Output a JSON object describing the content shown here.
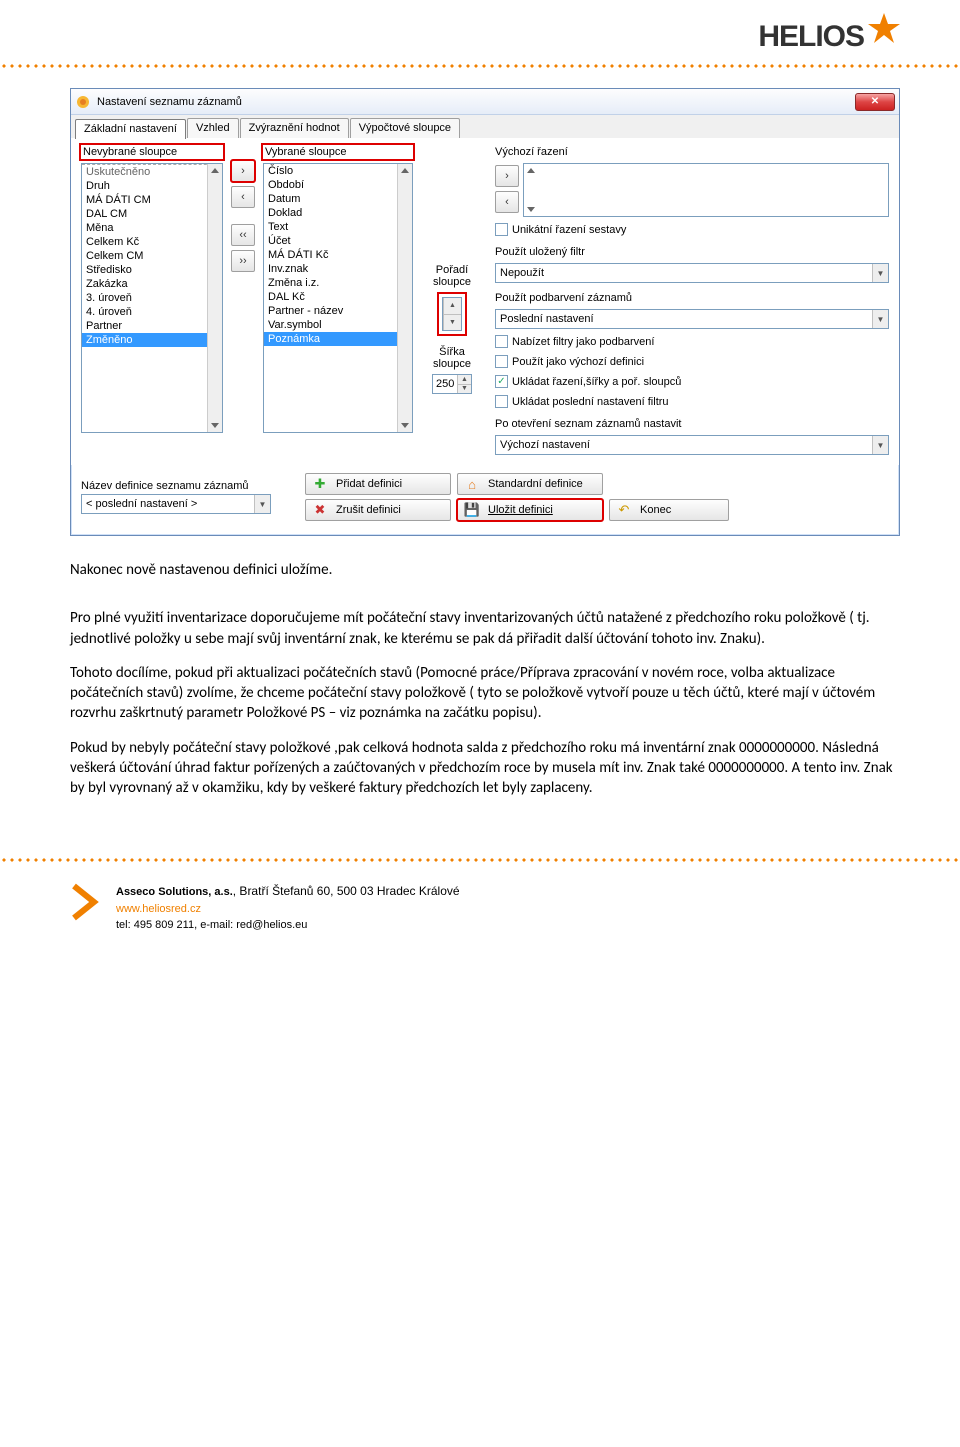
{
  "logo_text": "HELIOS",
  "window": {
    "title": "Nastavení seznamu záznamů",
    "tabs": [
      "Základní nastavení",
      "Vzhled",
      "Zvýraznění hodnot",
      "Výpočtové sloupce"
    ],
    "left_label": "Nevybrané sloupce",
    "left_items_first": "Uskutečněno",
    "left_items": [
      "Druh",
      "MÁ DÁTI  CM",
      "DAL  CM",
      "Měna",
      "Celkem Kč",
      "Celkem CM",
      "Středisko",
      "Zakázka",
      "3. úroveň",
      "4. úroveň",
      "Partner"
    ],
    "left_selected": "Změněno",
    "mid_label": "Vybrané sloupce",
    "mid_items": [
      "Číslo",
      "Období",
      "Datum",
      "Doklad",
      "Text",
      "Účet",
      "MÁ DÁTI  Kč",
      "Inv.znak",
      "Změna i.z.",
      "DAL  Kč",
      "Partner - název",
      "Var.symbol"
    ],
    "mid_selected": "Poznámka",
    "order_label": "Pořadí sloupce",
    "width_label": "Šířka sloupce",
    "width_value": "250",
    "right": {
      "sort_label": "Výchozí řazení",
      "unique_label": "Unikátní řazení sestavy",
      "filter_label": "Použít uložený filtr",
      "filter_value": "Nepoužít",
      "color_label": "Použít podbarvení záznamů",
      "color_value": "Poslední nastavení",
      "chk1": "Nabízet filtry jako podbarvení",
      "chk2": "Použít jako výchozí definici",
      "chk3": "Ukládat řazení,šířky a poř. sloupců",
      "chk4": "Ukládat poslední nastavení filtru",
      "open_label": "Po otevření seznam záznamů nastavit",
      "open_value": "Výchozí nastavení"
    },
    "bottom": {
      "def_label": "Název definice seznamu záznamů",
      "def_value": "< poslední nastavení >",
      "btn_add": "Přidat definici",
      "btn_std": "Standardní definice",
      "btn_del": "Zrušit definici",
      "btn_save": "Uložit definici",
      "btn_end": "Konec"
    }
  },
  "doc": {
    "p1": "Nakonec nově nastavenou definici uložíme.",
    "p2": "Pro plné využití inventarizace doporučujeme mít počáteční stavy inventarizovaných účtů natažené z předchozího roku položkově ( tj. jednotlivé položky u sebe mají svůj inventární znak, ke kterému se pak dá přiřadit další účtování tohoto inv. Znaku).",
    "p3": "Tohoto docílíme, pokud při aktualizaci počátečních stavů (Pomocné práce/Příprava zpracování v novém roce, volba aktualizace počátečních stavů) zvolíme, že chceme počáteční stavy položkově ( tyto se položkově vytvoří pouze u těch účtů, které mají v účtovém rozvrhu zaškrtnutý parametr  Položkové PS – viz poznámka na začátku popisu).",
    "p4": "Pokud by nebyly počáteční stavy položkové ,pak celková hodnota salda z předchozího roku má inventární znak 0000000000. Následná veškerá účtování  úhrad faktur pořízených a zaúčtovaných v předchozím roce by musela mít inv. Znak také 0000000000. A tento inv. Znak by byl vyrovnaný až v okamžiku, kdy by veškeré faktury předchozích let byly zaplaceny."
  },
  "footer": {
    "l1a": "Asseco Solutions, a.s.",
    "l1b": ", Bratří Štefanů 60, 500 03 Hradec Králové",
    "l2": "www.heliosred.cz",
    "l3": "tel: 495 809 211, e-mail: red@helios.eu"
  }
}
